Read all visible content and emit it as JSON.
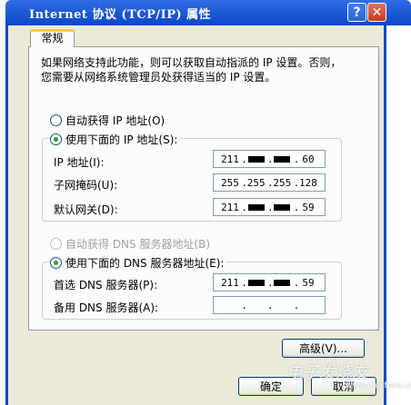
{
  "window": {
    "title": "Internet 协议 (TCP/IP) 属性",
    "help_label": "?",
    "close_label": "✕"
  },
  "tab": {
    "label": "常规"
  },
  "intro": {
    "line1": "如果网络支持此功能，则可以获取自动指派的 IP 设置。否则，",
    "line2": "您需要从网络系统管理员处获得适当的 IP 设置。"
  },
  "ip_mode": {
    "auto_label": "自动获得 IP 地址(O)",
    "manual_label": "使用下面的 IP 地址(S):",
    "selected": "manual"
  },
  "ip_fields": {
    "ip_label": "IP 地址(I):",
    "ip_value": [
      "211",
      "■",
      "■",
      "60"
    ],
    "mask_label": "子网掩码(U):",
    "mask_value": [
      "255",
      "255",
      "255",
      "128"
    ],
    "gateway_label": "默认网关(D):",
    "gateway_value": [
      "211",
      "■",
      "■",
      "59"
    ]
  },
  "dns_mode": {
    "auto_label": "自动获得 DNS 服务器地址(B)",
    "manual_label": "使用下面的 DNS 服务器地址(E):",
    "selected": "manual"
  },
  "dns_fields": {
    "preferred_label": "首选 DNS 服务器(P):",
    "preferred_value": [
      "211",
      "■",
      "■",
      "59"
    ],
    "alternate_label": "备用 DNS 服务器(A):",
    "alternate_value": [
      "",
      "",
      "",
      ""
    ]
  },
  "buttons": {
    "advanced": "高级(V)...",
    "ok": "确定",
    "cancel": "取消"
  },
  "watermark": {
    "main": "电子发烧友",
    "sub": "www.elecfans.com"
  }
}
